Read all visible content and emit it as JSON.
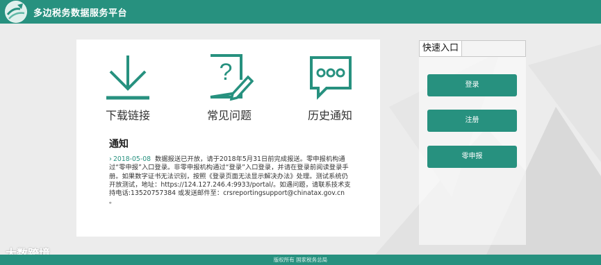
{
  "header": {
    "title": "多边税务数据服务平台"
  },
  "main": {
    "quick_links": [
      {
        "label": "下载链接",
        "icon": "download-icon"
      },
      {
        "label": "常见问题",
        "icon": "question-edit-icon"
      },
      {
        "label": "历史通知",
        "icon": "chat-bubble-icon"
      }
    ],
    "notice": {
      "title": "通知",
      "date": "2018-05-08",
      "body": "数据报送已开放，请于2018年5月31日前完成报送。零申报机构通过“零申报”入口登录。非零申报机构通过“登录”入口登录，并请在登录前阅读登录手册。如果数字证书无法识别，按照《登录页面无法显示解决办法》处理。测试系统仍开放测试，地址：https://124.127.246.4:9933/portal/。如遇问题，请联系技术支持电话:13520757384 或发送邮件至：crsreportingsupport@chinatax.gov.cn 。"
    }
  },
  "sidebar": {
    "tab": "快速入口",
    "buttons": {
      "login": "登录",
      "register": "注册",
      "zero": "零申报"
    }
  },
  "footer": {
    "text": "版权所有 国家税务总局"
  },
  "watermark": {
    "text": "大数跨境"
  },
  "colors": {
    "accent": "#27917f",
    "background": "#ececec"
  }
}
